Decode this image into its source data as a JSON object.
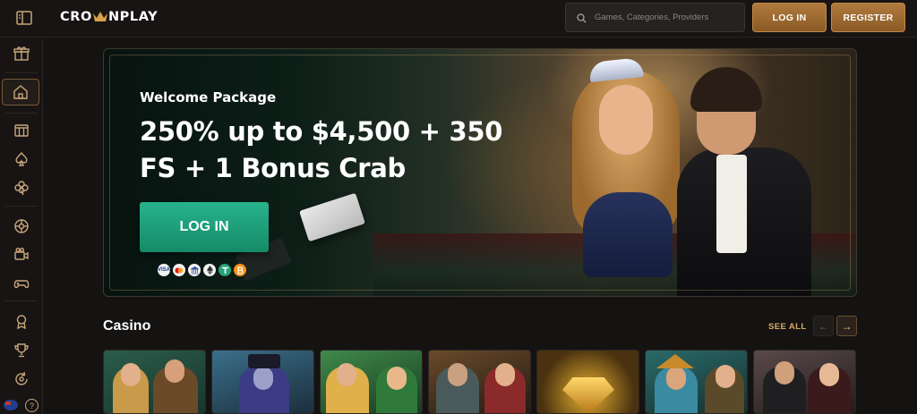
{
  "header": {
    "logo_text_left": "CRO",
    "logo_text_right": "NPLAY",
    "search_placeholder": "Games, Categories, Providers",
    "login_label": "LOG IN",
    "register_label": "REGISTER"
  },
  "sidebar": {
    "items": [
      {
        "icon": "gift-icon"
      },
      {
        "icon": "home-icon",
        "active": true
      },
      {
        "icon": "slot-machine-icon"
      },
      {
        "icon": "spade-icon"
      },
      {
        "icon": "clover-icon"
      },
      {
        "icon": "roulette-icon"
      },
      {
        "icon": "live-camera-icon"
      },
      {
        "icon": "gamepad-icon"
      },
      {
        "icon": "award-ribbon-icon"
      },
      {
        "icon": "trophy-icon"
      },
      {
        "icon": "refresh-bonus-icon"
      }
    ],
    "help_label": "?"
  },
  "banner": {
    "subtitle": "Welcome Package",
    "title": "250% up to $4,500 + 350 FS + 1 Bonus Crab",
    "login_label": "LOG IN",
    "payment_icons": [
      "visa-icon",
      "mastercard-icon",
      "bank-icon",
      "ethereum-icon",
      "tether-icon",
      "bitcoin-icon"
    ],
    "payment_labels": [
      "VISA",
      "",
      "",
      "",
      "",
      ""
    ]
  },
  "casino": {
    "title": "Casino",
    "see_all_label": "SEE ALL",
    "prev_label": "←",
    "next_label": "→",
    "tiles": [
      {
        "name": "viking-duo-slot"
      },
      {
        "name": "top-hat-gentleman-slot"
      },
      {
        "name": "leprechaun-girl-slot"
      },
      {
        "name": "pirate-crew-slot"
      },
      {
        "name": "golden-diamond-slot"
      },
      {
        "name": "aztec-warriors-slot"
      },
      {
        "name": "elegant-couple-slot"
      }
    ]
  },
  "colors": {
    "background": "#151312",
    "accent_gold": "#b07a3d",
    "banner_button": "#27b38c",
    "see_all": "#d7aa6a"
  }
}
